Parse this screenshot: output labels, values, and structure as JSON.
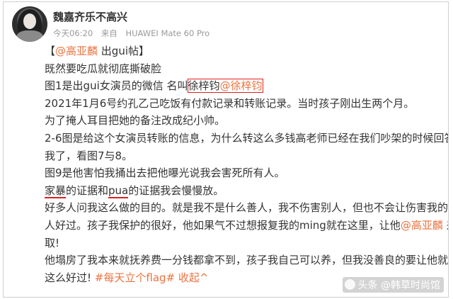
{
  "post": {
    "username": "魏嘉齐乐不高兴",
    "time": "今天06:20",
    "source_prefix": "来自",
    "device": "HUAWEI Mate 60 Pro"
  },
  "content": {
    "l1_bracket_open": "【",
    "l1_mention": "@高亚麟",
    "l1_rest": " 出gui帖】",
    "l2": "既然要吃瓜就彻底撕破脸",
    "l3_text": "图1是出gui女演员的微信 名叫",
    "l3_name": "徐梓钧",
    "l3_mention": "@徐梓钧",
    "l4": "2021年1月6号约孔乙己吃饭有付款记录和转账记录。当时孩子刚出生两个月。",
    "l5": "为了掩人耳目把她的备注改成纪小帅。",
    "l6": "2-6图是给这个女演员转账的信息，为什么转这么多钱高老师已经在我们吵架的时候回答",
    "l7": "我了，看图7与8。",
    "l8": "图9是他害怕我捅出去把他曝光说我会害死所有人。",
    "l9_a": "家暴",
    "l9_b": "的证据和",
    "l9_c": "pua",
    "l9_d": "的证据我会慢慢放。",
    "l10": "好多人问我这么做的目的。就是我不是什么善人，我不伤害别人，但也不会让伤害我的",
    "l11_text": "人好过。孩子我保护的很好，他如果气不过想报复我的ming就在这里，让他",
    "l11_mention": "@高亚麟",
    "l11_end": " 来",
    "l12": "取!",
    "l13": "他塌房了我本来就抚养费一分钱都拿不到，孩子我自己可以养，但我没善良的要让他就",
    "l14_text": "这么好过! ",
    "l14_topic": "#每天立个flag#",
    "l14_collapse": " 收起^"
  },
  "watermark": {
    "text": "头条 @韩草时尚馆"
  }
}
